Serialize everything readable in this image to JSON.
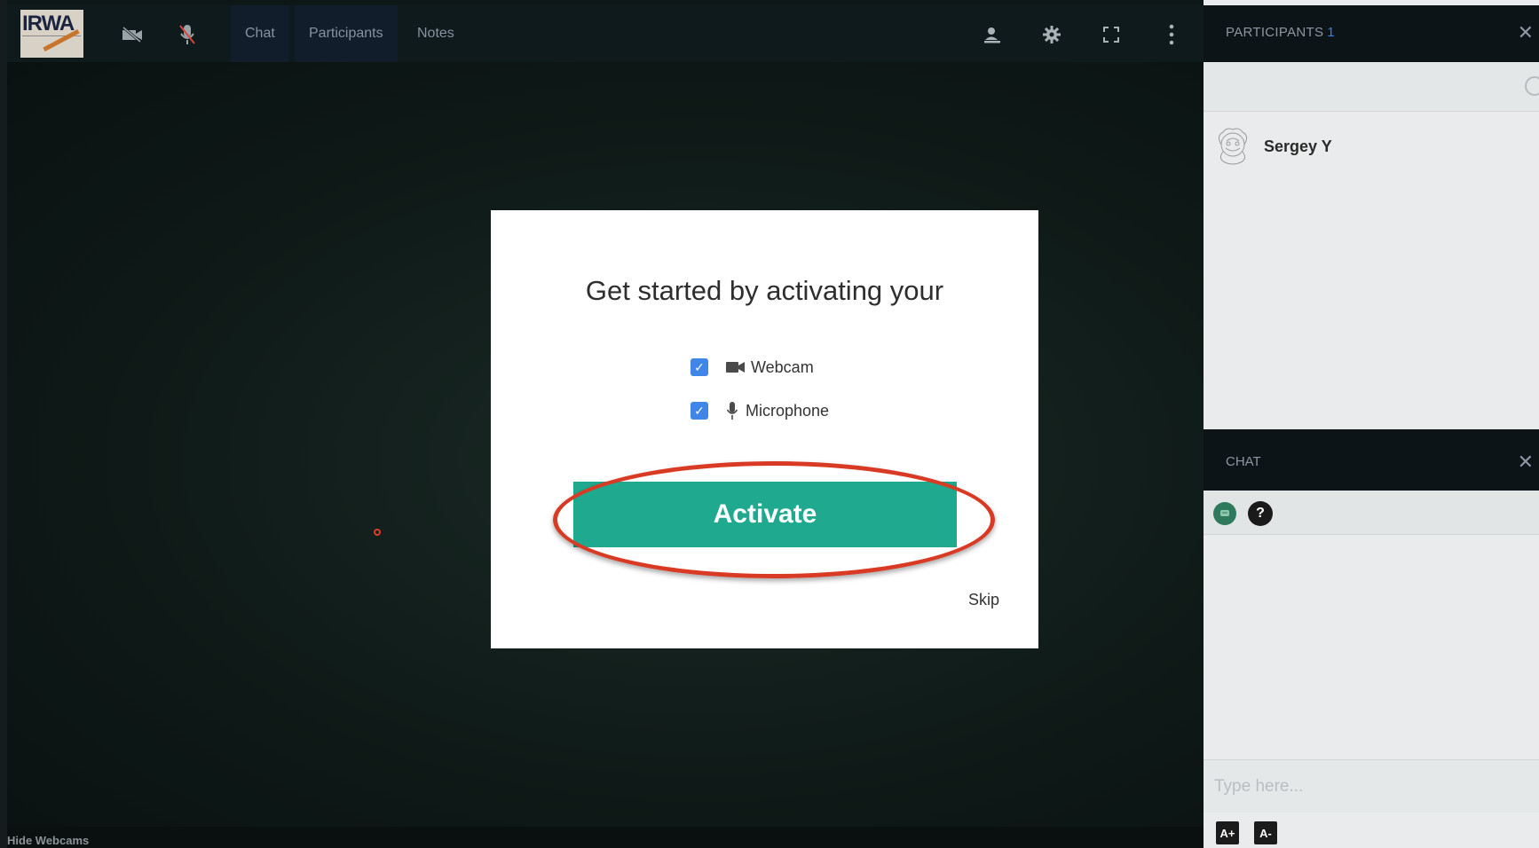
{
  "app": {
    "logo_text": "IRWA"
  },
  "topbar": {
    "camera_icon": "camera-off-icon",
    "mic_icon": "mic-off-icon",
    "tabs": [
      {
        "label": "Chat",
        "active": true
      },
      {
        "label": "Participants",
        "active": true
      },
      {
        "label": "Notes",
        "active": false
      }
    ],
    "right_icons": [
      "presenter-icon",
      "gear-icon",
      "fullscreen-icon",
      "more-vertical-icon"
    ]
  },
  "stage": {
    "hide_webcams_label": "Hide Webcams"
  },
  "modal": {
    "title": "Get started by activating your",
    "options": [
      {
        "label": "Webcam",
        "checked": true,
        "icon": "video-camera-icon"
      },
      {
        "label": "Microphone",
        "checked": true,
        "icon": "microphone-icon"
      }
    ],
    "activate_label": "Activate",
    "skip_label": "Skip",
    "accent_color": "#1fa98f",
    "highlight_color": "#d93a24"
  },
  "participants_panel": {
    "title": "PARTICIPANTS",
    "count": "1",
    "participants": [
      {
        "name": "Sergey Y"
      }
    ]
  },
  "chat_panel": {
    "title": "CHAT",
    "input_placeholder": "Type here...",
    "font_increase_label": "A+",
    "font_decrease_label": "A-",
    "help_label": "?"
  }
}
